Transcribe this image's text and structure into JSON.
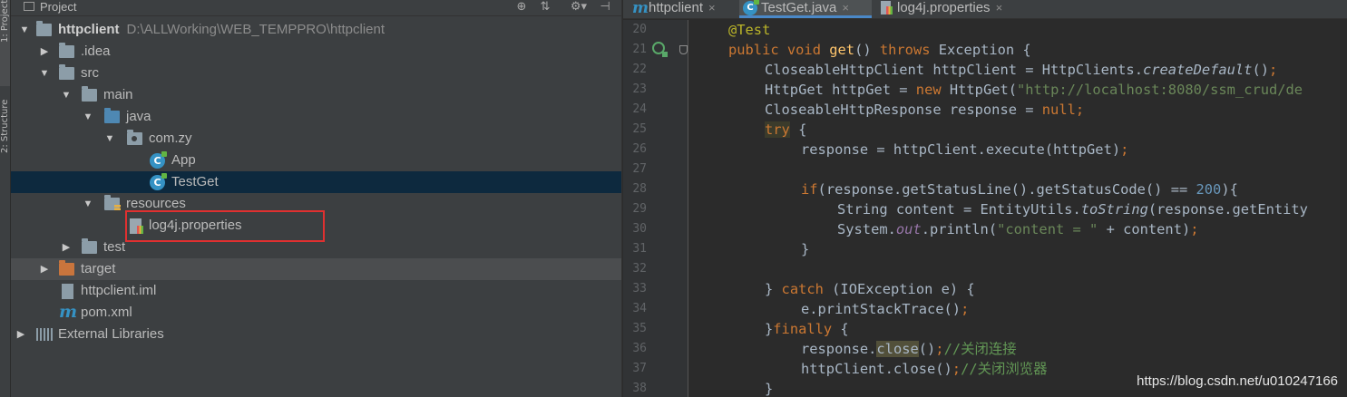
{
  "toolstrip": {
    "project_tab": "1: Project",
    "structure_tab": "2: Structure"
  },
  "project_panel": {
    "title": "Project",
    "header_icons": [
      "target-icon",
      "collapse-icon",
      "gear-icon",
      "hide-icon"
    ],
    "header_glyphs": {
      "target": "⊕",
      "collapse": "⇅",
      "gear": "⚙▾",
      "hide": "⊣"
    }
  },
  "tree": {
    "root": {
      "label": "httpclient",
      "path": "D:\\ALLWorking\\WEB_TEMPPRO\\httpclient"
    },
    "idea": ".idea",
    "src": "src",
    "main": "main",
    "java": "java",
    "package": "com.zy",
    "app": "App",
    "testget": "TestGet",
    "resources": "resources",
    "log4j": "log4j.properties",
    "test": "test",
    "target": "target",
    "iml": "httpclient.iml",
    "pom": "pom.xml",
    "external": "External Libraries"
  },
  "editor": {
    "tabs": [
      {
        "label": "httpclient",
        "icon": "maven-icon",
        "glyph": "m",
        "close": "×"
      },
      {
        "label": "TestGet.java",
        "icon": "class-icon",
        "glyph": "C",
        "close": "×"
      },
      {
        "label": "log4j.properties",
        "icon": "properties-icon",
        "glyph": "",
        "close": "×"
      }
    ],
    "line_numbers": [
      "20",
      "21",
      "22",
      "23",
      "24",
      "25",
      "26",
      "27",
      "28",
      "29",
      "30",
      "31",
      "32",
      "33",
      "34",
      "35",
      "36",
      "37",
      "38"
    ]
  },
  "code_tokens": {
    "l20": [
      "@Test"
    ],
    "l21": [
      "public",
      " ",
      "void",
      " ",
      "get",
      "() ",
      "throws",
      " Exception {"
    ],
    "l22": [
      "CloseableHttpClient httpClient = HttpClients.",
      "createDefault",
      "()",
      ";"
    ],
    "l23": [
      "HttpGet httpGet = ",
      "new",
      " HttpGet(",
      "\"http://localhost:8080/ssm_crud/de"
    ],
    "l24": [
      "CloseableHttpResponse response = ",
      "null",
      ";"
    ],
    "l25": [
      "try",
      " {"
    ],
    "l26": [
      "response = httpClient.execute(httpGet)",
      ";"
    ],
    "l27": [
      ""
    ],
    "l28": [
      "if",
      "(response.getStatusLine().getStatusCode() == ",
      "200",
      "){"
    ],
    "l29": [
      "String content = EntityUtils.",
      "toString",
      "(response.getEntity"
    ],
    "l30": [
      "System.",
      "out",
      ".println(",
      "\"content = \"",
      " + content)",
      ";"
    ],
    "l31": [
      "}"
    ],
    "l32": [
      ""
    ],
    "l33": [
      "} ",
      "catch",
      " (IOException e) {"
    ],
    "l34": [
      "e.printStackTrace()",
      ";"
    ],
    "l35": [
      "}",
      "finally",
      " {"
    ],
    "l36": [
      "response.",
      "close",
      "()",
      ";",
      "//关闭连接"
    ],
    "l37": [
      "httpClient.close()",
      ";",
      "//关闭浏览器"
    ],
    "l38": [
      "}"
    ]
  },
  "watermark": "https://blog.csdn.net/u010247166",
  "colors": {
    "keyword": "#cc7832",
    "annotation": "#bbb529",
    "method_decl": "#ffc66d",
    "string": "#6a8759",
    "number": "#6897bb",
    "static_field": "#9876aa",
    "comment": "#629755",
    "plain": "#a9b7c6",
    "highlight_box": "#e03030",
    "selected_row": "#0d293e"
  }
}
